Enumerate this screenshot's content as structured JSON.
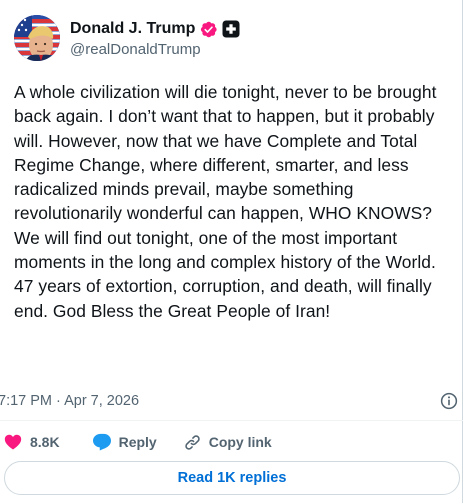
{
  "author": {
    "display_name": "Donald J. Trump",
    "handle": "@realDonaldTrump",
    "avatar_icon": "profile-photo-icon",
    "verified_badge_color": "#f91880",
    "affiliate_badge_icon": "plus-square-icon"
  },
  "tweet": {
    "text": "A whole civilization will die tonight, never to be brought back again. I don’t want that to happen, but it probably will. However, now that we have Complete and Total Regime Change, where different, smarter, and less radicalized minds prevail, maybe something revolutionarily wonderful can happen, WHO KNOWS? We will find out tonight, one of the most important moments in the long and complex history of the World. 47 years of extortion, corruption, and death, will finally end. God Bless the Great People of Iran!",
    "timestamp": "7:17 PM · Apr 7, 2026"
  },
  "actions": {
    "like_count": "8.8K",
    "reply_label": "Reply",
    "copy_label": "Copy link",
    "like_color": "#f91880",
    "reply_color": "#1d9bf0"
  },
  "footer": {
    "read_replies_label": "Read 1K replies"
  },
  "colors": {
    "text_primary": "#0f1419",
    "text_secondary": "#536471",
    "link_blue": "#006fd6",
    "border": "#cfd9de"
  }
}
